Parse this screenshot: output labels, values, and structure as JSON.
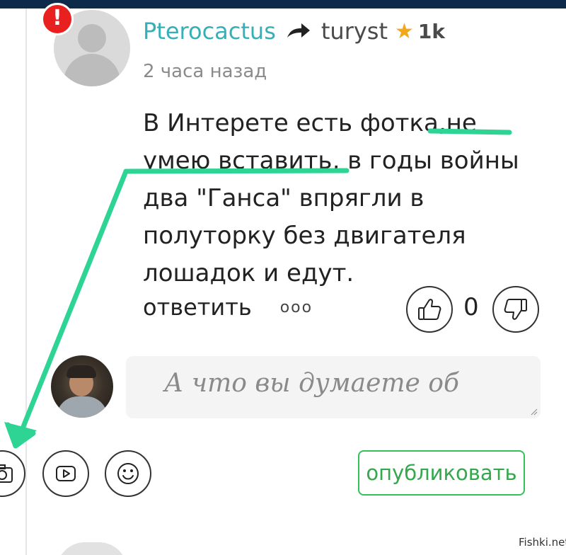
{
  "comment": {
    "author": "Pterocactus",
    "reply_to": "turyst",
    "reply_to_karma": "1k",
    "timestamp": "2 часа назад",
    "text": "В Интерете есть фотка,не\nумею вставить, в годы войны\nдва \"Ганса\" впрягли в\nполуторку без двигателя\nлошадок и едут.",
    "reply_label": "ответить",
    "more_label": "ooo",
    "vote_count": "0",
    "alert_mark": "!"
  },
  "composer": {
    "placeholder": "А что вы думаете об",
    "publish_label": "опубликовать"
  },
  "icons": {
    "reply_arrow": "arrow-right-icon",
    "star": "star-icon",
    "like": "thumbs-up-icon",
    "dislike": "thumbs-down-icon",
    "camera": "camera-icon",
    "video": "video-icon",
    "emoji": "emoji-icon"
  },
  "colors": {
    "author": "#35b0b8",
    "star": "#f3a81b",
    "alert": "#e8201f",
    "annotation": "#2dd494",
    "publish": "#35c05a",
    "top_bar": "#0d2a4a"
  },
  "watermark": "Fishki.net"
}
